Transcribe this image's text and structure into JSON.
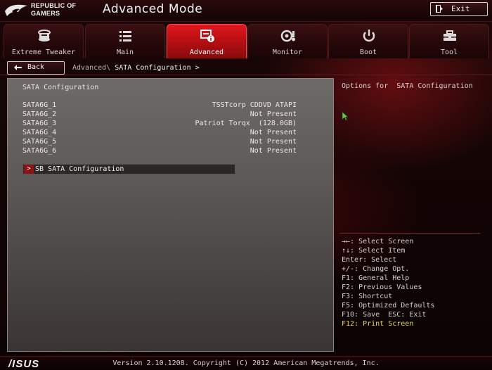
{
  "brand": {
    "line1": "REPUBLIC OF",
    "line2": "GAMERS"
  },
  "header": {
    "mode_title": "Advanced Mode",
    "exit_label": "Exit"
  },
  "tabs": [
    {
      "label": "Extreme Tweaker",
      "icon": "tweaker-icon",
      "active": false
    },
    {
      "label": "Main",
      "icon": "list-icon",
      "active": false
    },
    {
      "label": "Advanced",
      "icon": "advanced-settings-icon",
      "active": true
    },
    {
      "label": "Monitor",
      "icon": "monitor-icon",
      "active": false
    },
    {
      "label": "Boot",
      "icon": "power-icon",
      "active": false
    },
    {
      "label": "Tool",
      "icon": "toolbox-icon",
      "active": false
    }
  ],
  "nav": {
    "back_label": "Back",
    "breadcrumb_parent": "Advanced\\",
    "breadcrumb_current": "SATA Configuration >"
  },
  "main": {
    "title": "SATA Configuration",
    "ports": [
      {
        "name": "SATA6G_1",
        "value": "TSSTcorp CDDVD ATAPI"
      },
      {
        "name": "SATA6G_2",
        "value": "Not Present"
      },
      {
        "name": "SATA6G_3",
        "value": "Patriot Torqx  (128.0GB)"
      },
      {
        "name": "SATA6G_4",
        "value": "Not Present"
      },
      {
        "name": "SATA6G_5",
        "value": "Not Present"
      },
      {
        "name": "SATA6G_6",
        "value": "Not Present"
      }
    ],
    "submenu_label": "SB SATA Configuration",
    "submenu_arrow": ">"
  },
  "help": {
    "description": "Options for  SATA Configuration",
    "keys": [
      "→←: Select Screen",
      "↑↓: Select Item",
      "Enter: Select",
      "+/-: Change Opt.",
      "F1: General Help",
      "F2: Previous Values",
      "F3: Shortcut",
      "F5: Optimized Defaults",
      "F10: Save  ESC: Exit",
      "F12: Print Screen"
    ]
  },
  "footer": {
    "logo_text": "/ISUS",
    "version": "Version 2.10.1208. Copyright (C) 2012 American Megatrends, Inc."
  },
  "colors": {
    "accent": "#d0141a",
    "highlight_key": "#f0d44a"
  }
}
